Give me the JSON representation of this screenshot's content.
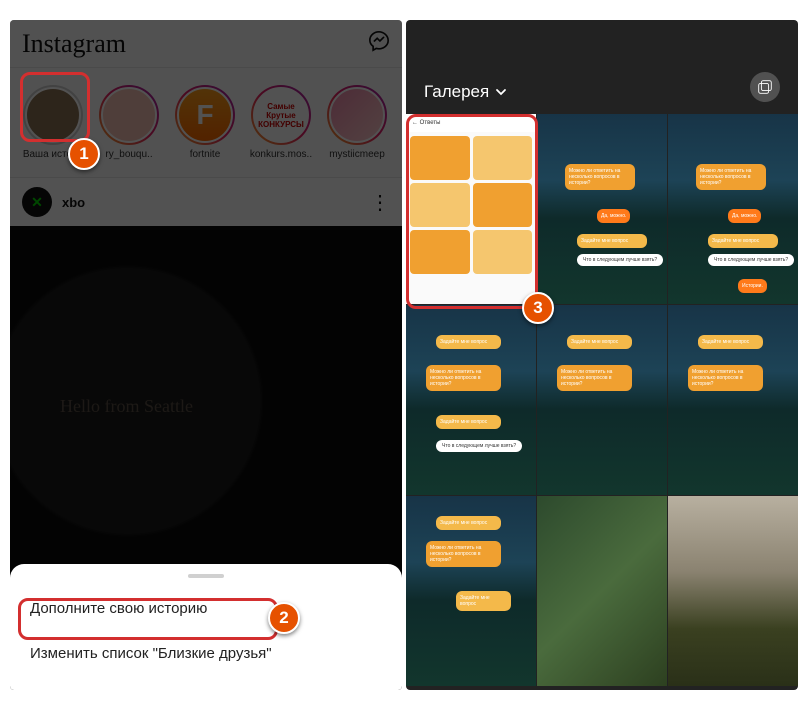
{
  "annotations": {
    "one": "1",
    "two": "2",
    "three": "3"
  },
  "left": {
    "logo": "Instagram",
    "stories": {
      "your": "Ваша истор..",
      "bouquet": "ry_bouqu..",
      "fortnite": "fortnite",
      "fortnite_letter": "F",
      "konkurs": "konkurs.mos..",
      "konkurs_inner": "Самые Крутые КОНКУРСЫ",
      "mystic": "mystiicmeep"
    },
    "post": {
      "user_avatar": "✕",
      "username": "xbo",
      "caption": "Hello from Seattle"
    },
    "sheet": {
      "add_story": "Дополните свою историю",
      "close_friends": "Изменить список \"Близкие друзья\""
    }
  },
  "right": {
    "title": "Галерея",
    "thumb1_header": "Ответы",
    "sticker_q1": "Можно ли ответить на несколько вопросов в истории?",
    "sticker_a1": "Да, можно.",
    "sticker_ask": "Задайте мне вопрос",
    "sticker_q2": "Что в следующем лучше взять?",
    "sticker_a2": "Истории."
  }
}
